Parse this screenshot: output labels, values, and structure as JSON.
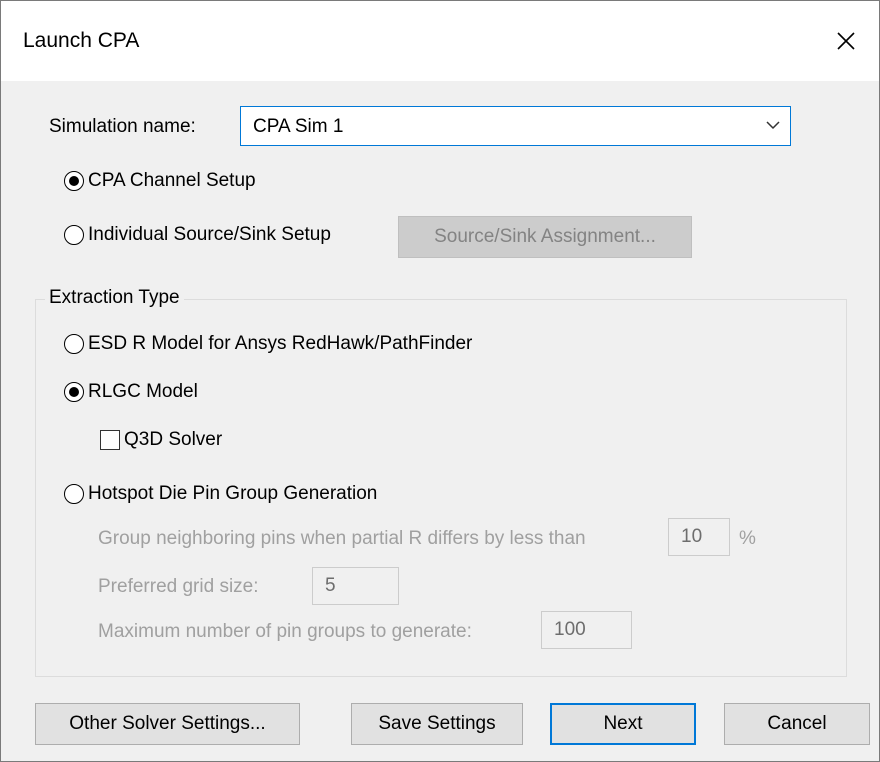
{
  "window": {
    "title": "Launch CPA",
    "close_icon": "close-icon"
  },
  "simulation": {
    "label": "Simulation name:",
    "value": "CPA Sim 1",
    "dropdown_icon": "chevron-down-icon"
  },
  "setup": {
    "channel_label": "CPA Channel Setup",
    "channel_selected": true,
    "individual_label": "Individual Source/Sink Setup",
    "individual_selected": false,
    "assignment_button": "Source/Sink Assignment..."
  },
  "extraction": {
    "group_title": "Extraction Type",
    "esd_label": "ESD R Model for Ansys RedHawk/PathFinder",
    "esd_selected": false,
    "rlgc_label": "RLGC Model",
    "rlgc_selected": true,
    "q3d_label": "Q3D Solver",
    "q3d_checked": false,
    "hotspot_label": "Hotspot Die Pin Group Generation",
    "hotspot_selected": false,
    "group_neighbor_label": "Group neighboring pins when partial R differs by less than",
    "group_neighbor_value": "10",
    "group_neighbor_unit": "%",
    "grid_size_label": "Preferred grid size:",
    "grid_size_value": "5",
    "max_groups_label": "Maximum number of pin groups to generate:",
    "max_groups_value": "100"
  },
  "buttons": {
    "other": "Other Solver Settings...",
    "save": "Save Settings",
    "next": "Next",
    "cancel": "Cancel"
  },
  "colors": {
    "focus_accent": "#0078d7",
    "dialog_bg": "#f0f0f0",
    "disabled_text": "#a0a0a0"
  }
}
